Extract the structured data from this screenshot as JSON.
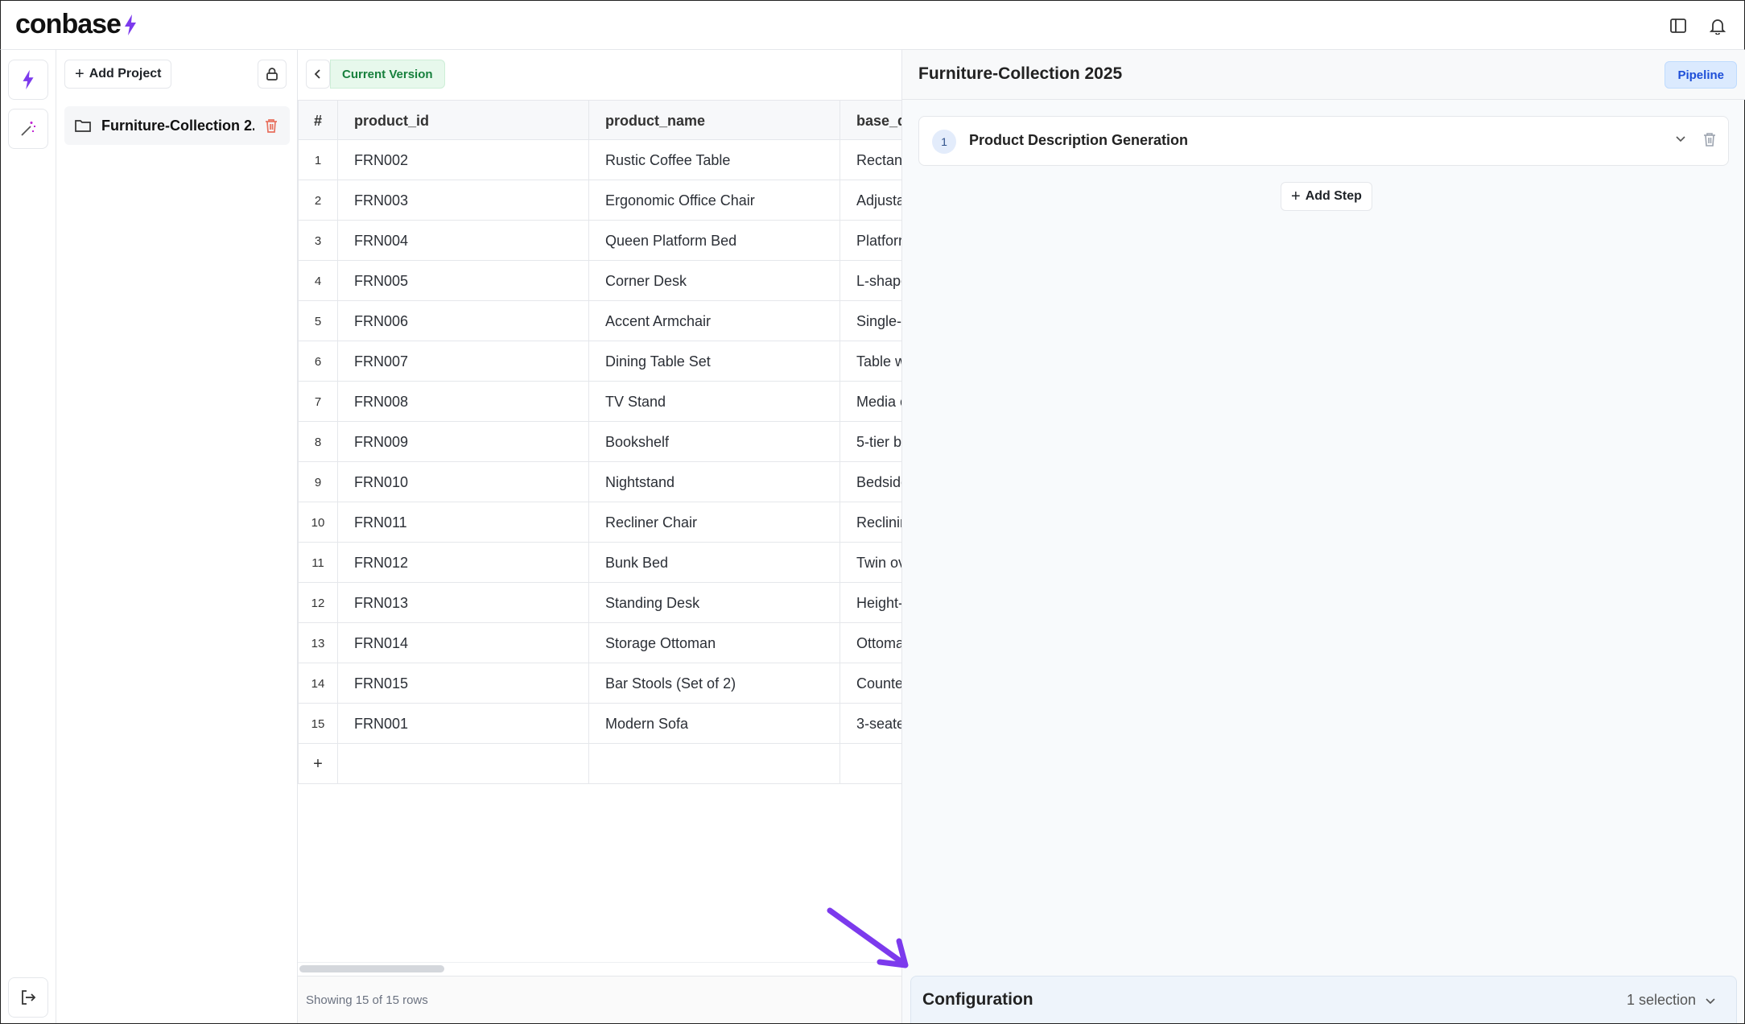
{
  "app": {
    "logo_text": "conbase",
    "brand_color": "#7c3aed"
  },
  "topbar": {
    "icons": [
      "sidebar-toggle-icon",
      "bell-icon"
    ]
  },
  "rail": {
    "items": [
      "lightning-icon",
      "magic-wand-icon"
    ],
    "bottom": "logout-icon"
  },
  "projects": {
    "add_label": "Add Project",
    "items": [
      {
        "name": "Furniture-Collection 2..."
      }
    ]
  },
  "table": {
    "version_label": "Current Version",
    "columns": [
      "#",
      "product_id",
      "product_name",
      "base_d"
    ],
    "rows": [
      {
        "n": "1",
        "id": "FRN002",
        "name": "Rustic Coffee Table",
        "desc": "Rectang"
      },
      {
        "n": "2",
        "id": "FRN003",
        "name": "Ergonomic Office Chair",
        "desc": "Adjusta"
      },
      {
        "n": "3",
        "id": "FRN004",
        "name": "Queen Platform Bed",
        "desc": "Platforr"
      },
      {
        "n": "4",
        "id": "FRN005",
        "name": "Corner Desk",
        "desc": "L-shape"
      },
      {
        "n": "5",
        "id": "FRN006",
        "name": "Accent Armchair",
        "desc": "Single-s"
      },
      {
        "n": "6",
        "id": "FRN007",
        "name": "Dining Table Set",
        "desc": "Table w"
      },
      {
        "n": "7",
        "id": "FRN008",
        "name": "TV Stand",
        "desc": "Media c"
      },
      {
        "n": "8",
        "id": "FRN009",
        "name": "Bookshelf",
        "desc": "5-tier b"
      },
      {
        "n": "9",
        "id": "FRN010",
        "name": "Nightstand",
        "desc": "Bedside"
      },
      {
        "n": "10",
        "id": "FRN011",
        "name": "Recliner Chair",
        "desc": "Reclinin"
      },
      {
        "n": "11",
        "id": "FRN012",
        "name": "Bunk Bed",
        "desc": "Twin ov"
      },
      {
        "n": "12",
        "id": "FRN013",
        "name": "Standing Desk",
        "desc": "Height-"
      },
      {
        "n": "13",
        "id": "FRN014",
        "name": "Storage Ottoman",
        "desc": "Ottoma"
      },
      {
        "n": "14",
        "id": "FRN015",
        "name": "Bar Stools (Set of 2)",
        "desc": "Counte"
      },
      {
        "n": "15",
        "id": "FRN001",
        "name": "Modern Sofa",
        "desc": "3-seate"
      }
    ],
    "add_row_label": "+",
    "footer": "Showing 15 of 15 rows"
  },
  "pipeline": {
    "title": "Furniture-Collection 2025",
    "mode_label": "Pipeline",
    "steps": [
      {
        "num": "1",
        "title": "Product Description Generation"
      }
    ],
    "add_step_label": "Add Step",
    "config_title": "Configuration",
    "config_selection": "1 selection"
  }
}
